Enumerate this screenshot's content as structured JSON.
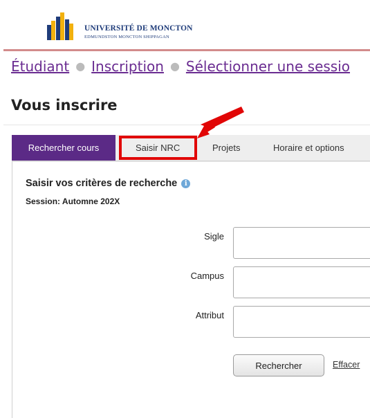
{
  "header": {
    "university_name": "UNIVERSITÉ DE MONCTON",
    "campuses": "EDMUNDSTON MONCTON SHIPPAGAN",
    "brand_colors": {
      "gold": "#f2b10e",
      "navy": "#1f3c7a"
    }
  },
  "breadcrumb": {
    "items": [
      "Étudiant",
      "Inscription",
      "Sélectionner une sessio"
    ]
  },
  "page": {
    "title": "Vous inscrire"
  },
  "tabs": [
    {
      "label": "Rechercher cours",
      "active": true
    },
    {
      "label": "Saisir NRC",
      "active": false
    },
    {
      "label": "Projets",
      "active": false
    },
    {
      "label": "Horaire et options",
      "active": false
    }
  ],
  "search_form": {
    "heading": "Saisir vos critères de recherche",
    "info_icon": "info-icon",
    "session_label": "Session: Automne 202X",
    "fields": [
      {
        "label": "Sigle",
        "value": ""
      },
      {
        "label": "Campus",
        "value": ""
      },
      {
        "label": "Attribut",
        "value": ""
      }
    ],
    "search_button": "Rechercher",
    "clear_link": "Effacer"
  },
  "annotation": {
    "color": "#e10606",
    "arrow_icon": "red-arrow-icon"
  }
}
